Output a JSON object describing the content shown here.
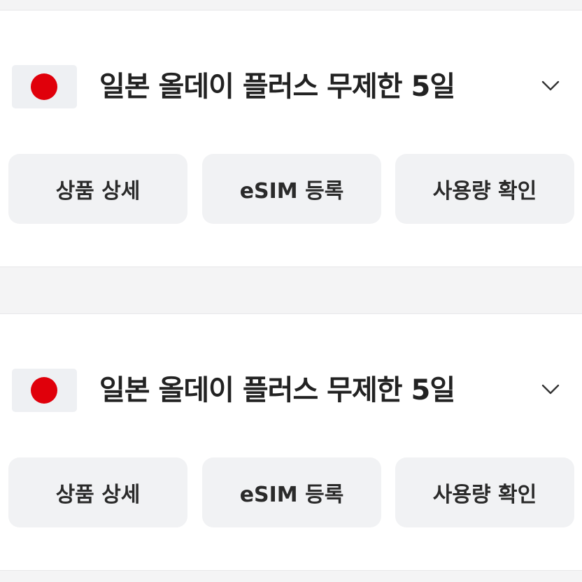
{
  "items": [
    {
      "flag_icon": "japan-flag-icon",
      "title": "일본 올데이 플러스 무제한 5일",
      "expand_icon": "chevron-down-icon",
      "buttons": {
        "detail": "상품 상세",
        "register": "eSIM 등록",
        "usage": "사용량 확인"
      }
    },
    {
      "flag_icon": "japan-flag-icon",
      "title": "일본 올데이 플러스 무제한 5일",
      "expand_icon": "chevron-down-icon",
      "buttons": {
        "detail": "상품 상세",
        "register": "eSIM 등록",
        "usage": "사용량 확인"
      }
    }
  ],
  "colors": {
    "flag_red": "#e0000b",
    "flag_bg": "#eef0f3",
    "button_bg": "#f1f2f4",
    "page_bg": "#f4f4f5",
    "card_bg": "#ffffff",
    "text": "#222222"
  }
}
